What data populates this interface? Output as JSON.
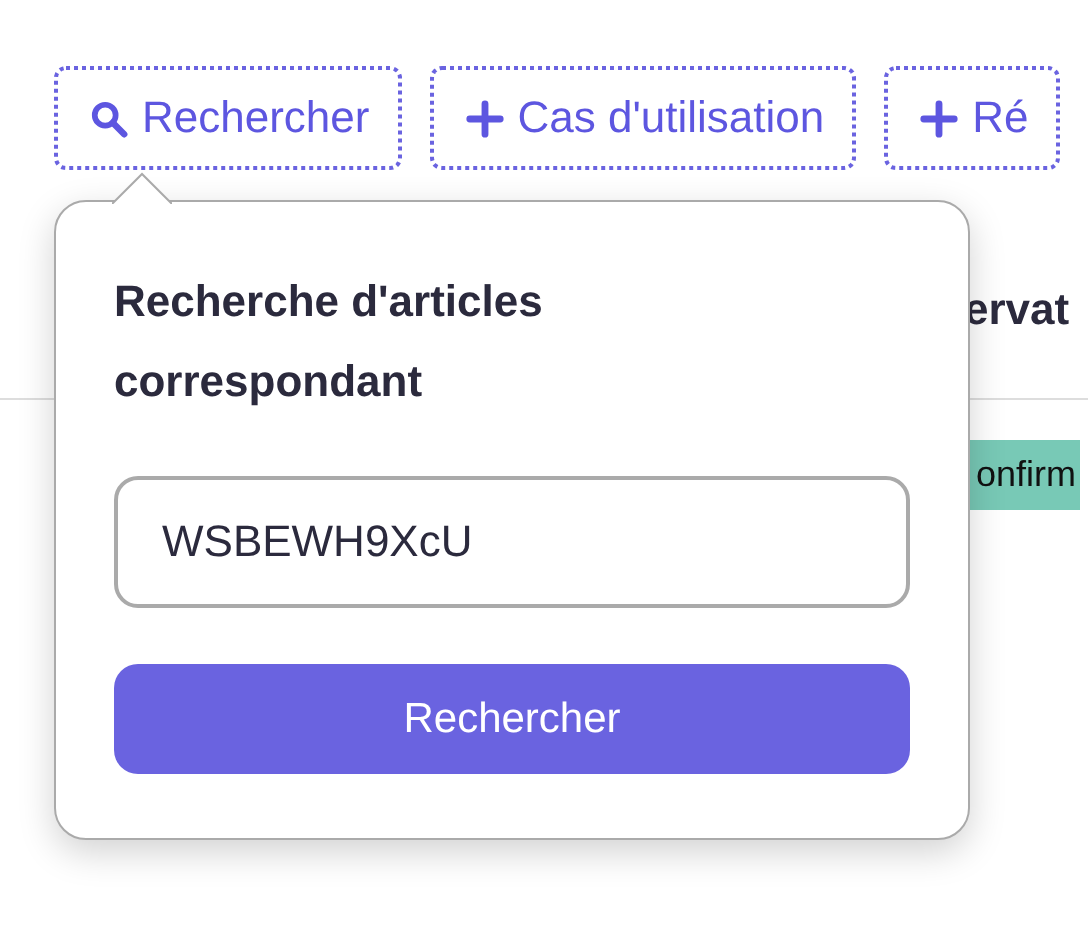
{
  "toolbar": [
    {
      "kind": "search",
      "label": "Rechercher"
    },
    {
      "kind": "add",
      "label": "Cas d'utilisation"
    },
    {
      "kind": "add",
      "label": "Ré"
    }
  ],
  "table": {
    "column_header": "ervat",
    "status_badge": "onfirm"
  },
  "popover": {
    "title": "Recherche d'articles correspondant",
    "field": {
      "value": "WSBEWH9XcU"
    },
    "button": "Rechercher"
  }
}
